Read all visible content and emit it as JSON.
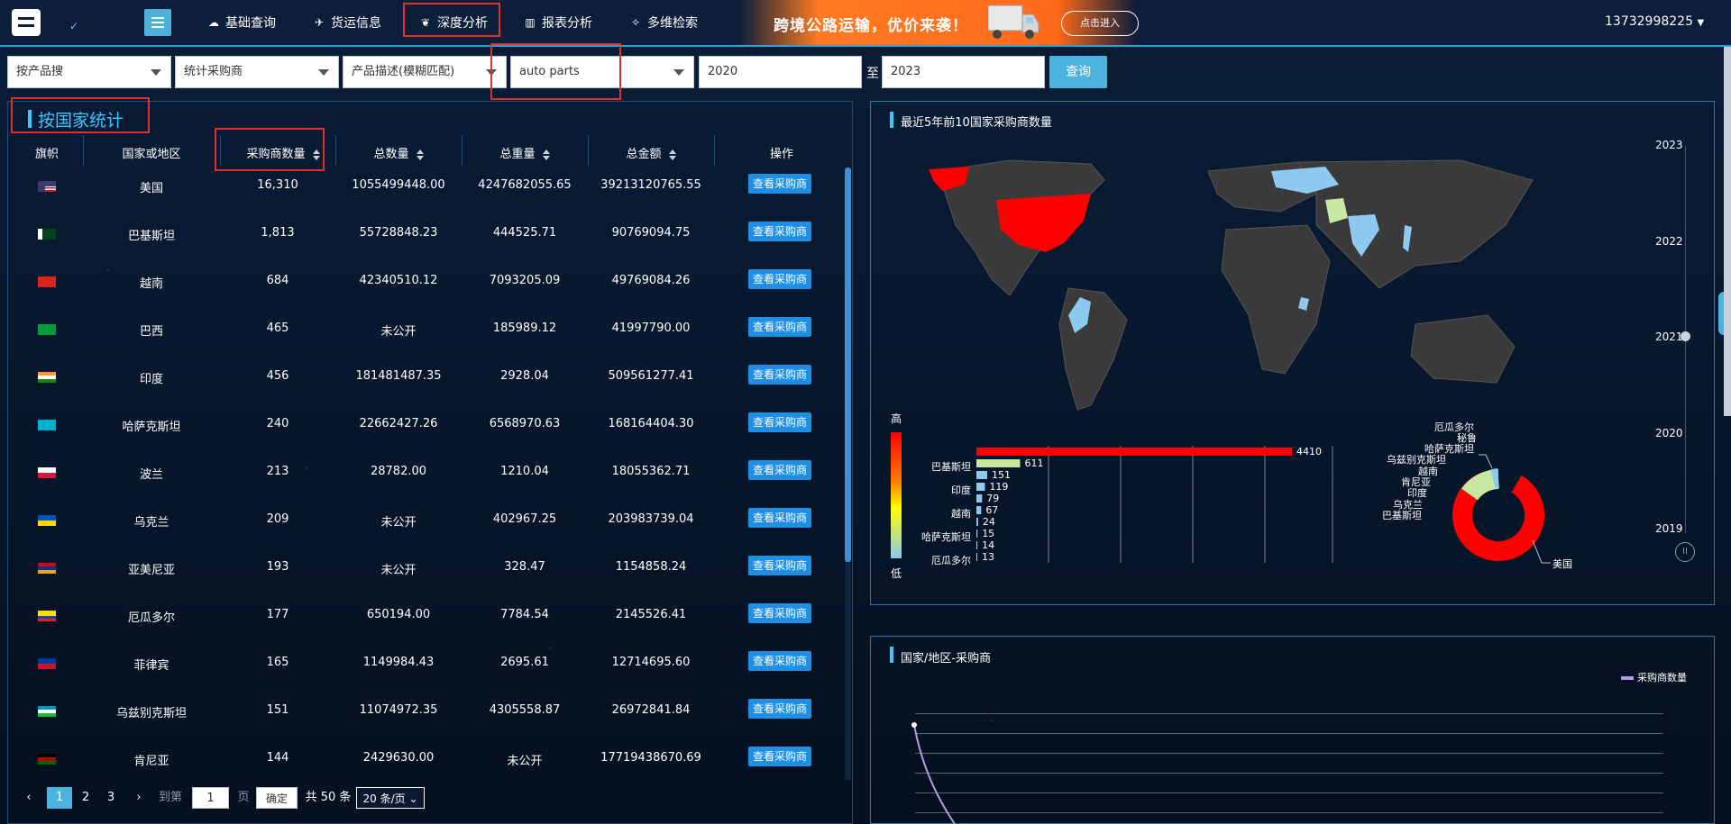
{
  "topbar": {
    "nav": [
      {
        "label": "基础查询",
        "icon": "cloud-icon"
      },
      {
        "label": "货运信息",
        "icon": "airplane-icon"
      },
      {
        "label": "深度分析",
        "icon": "analysis-icon"
      },
      {
        "label": "报表分析",
        "icon": "chart-icon"
      },
      {
        "label": "多维检索",
        "icon": "compass-icon"
      }
    ],
    "banner_text": "跨境公路运输，优价来袭！",
    "banner_button": "点击进入",
    "user": "13732998225"
  },
  "filters": {
    "search_by": "按产品搜",
    "stat_type": "统计采购商",
    "match_type": "产品描述(模糊匹配)",
    "keyword": "auto parts",
    "year_from": "2020",
    "to_label": "至",
    "year_to": "2023",
    "query_button": "查询"
  },
  "left": {
    "title": "按国家统计",
    "columns": [
      "旗帜",
      "国家或地区",
      "采购商数量",
      "总数量",
      "总重量",
      "总金额",
      "操作"
    ],
    "action_label": "查看采购商",
    "rows": [
      {
        "flag": "us",
        "country": "美国",
        "buyers": "16,310",
        "qty": "1055499448.00",
        "weight": "4247682055.65",
        "amount": "39213120765.55"
      },
      {
        "flag": "pk",
        "country": "巴基斯坦",
        "buyers": "1,813",
        "qty": "55728848.23",
        "weight": "444525.71",
        "amount": "90769094.75"
      },
      {
        "flag": "vn",
        "country": "越南",
        "buyers": "684",
        "qty": "42340510.12",
        "weight": "7093205.09",
        "amount": "49769084.26"
      },
      {
        "flag": "br",
        "country": "巴西",
        "buyers": "465",
        "qty": "未公开",
        "weight": "185989.12",
        "amount": "41997790.00"
      },
      {
        "flag": "in",
        "country": "印度",
        "buyers": "456",
        "qty": "181481487.35",
        "weight": "2928.04",
        "amount": "509561277.41"
      },
      {
        "flag": "kz",
        "country": "哈萨克斯坦",
        "buyers": "240",
        "qty": "22662427.26",
        "weight": "6568970.63",
        "amount": "168164404.30"
      },
      {
        "flag": "pl",
        "country": "波兰",
        "buyers": "213",
        "qty": "28782.00",
        "weight": "1210.04",
        "amount": "18055362.71"
      },
      {
        "flag": "ua",
        "country": "乌克兰",
        "buyers": "209",
        "qty": "未公开",
        "weight": "402967.25",
        "amount": "203983739.04"
      },
      {
        "flag": "am",
        "country": "亚美尼亚",
        "buyers": "193",
        "qty": "未公开",
        "weight": "328.47",
        "amount": "1154858.24"
      },
      {
        "flag": "ec",
        "country": "厄瓜多尔",
        "buyers": "177",
        "qty": "650194.00",
        "weight": "7784.54",
        "amount": "2145526.41"
      },
      {
        "flag": "ph",
        "country": "菲律宾",
        "buyers": "165",
        "qty": "1149984.43",
        "weight": "2695.61",
        "amount": "12714695.60"
      },
      {
        "flag": "uz",
        "country": "乌兹别克斯坦",
        "buyers": "151",
        "qty": "11074972.35",
        "weight": "4305558.87",
        "amount": "26972841.84"
      },
      {
        "flag": "ke",
        "country": "肯尼亚",
        "buyers": "144",
        "qty": "2429630.00",
        "weight": "未公开",
        "amount": "17719438670.69"
      }
    ],
    "pager": {
      "prev": "‹",
      "pages": [
        "1",
        "2",
        "3"
      ],
      "next": "›",
      "goto": "到第",
      "goto_value": "1",
      "page_unit": "页",
      "confirm": "确定",
      "total": "共 50 条",
      "page_size": "20 条/页"
    }
  },
  "right_top": {
    "title": "最近5年前10国家采购商数量",
    "legend_high": "高",
    "legend_low": "低",
    "years": [
      "2023",
      "2022",
      "2021",
      "2020",
      "2019"
    ],
    "bar_labels": [
      "巴基斯坦",
      "印度",
      "越南",
      "哈萨克斯坦",
      "厄瓜多尔"
    ],
    "bar_values": [
      4410,
      611,
      151,
      119,
      79,
      67,
      24,
      15,
      14,
      13
    ],
    "bar_colors": [
      "#ff0000",
      "#c7e8a0",
      "#8ec9ef",
      "#8ec9ef",
      "#8ec9ef",
      "#8ec9ef",
      "#8ec9ef",
      "#8ec9ef",
      "#8ec9ef",
      "#8ec9ef"
    ],
    "pie_labels": [
      "厄瓜多尔",
      "秘鲁",
      "哈萨克斯坦",
      "乌兹别克斯坦",
      "越南",
      "肯尼亚",
      "印度",
      "乌克兰",
      "巴基斯坦",
      "美国"
    ]
  },
  "right_bottom": {
    "title": "国家/地区-采购商",
    "legend": "采购商数量"
  },
  "colors": {
    "accent": "#4bb3dd",
    "highlight": "#e0302b",
    "map_high": "#ff0000"
  }
}
